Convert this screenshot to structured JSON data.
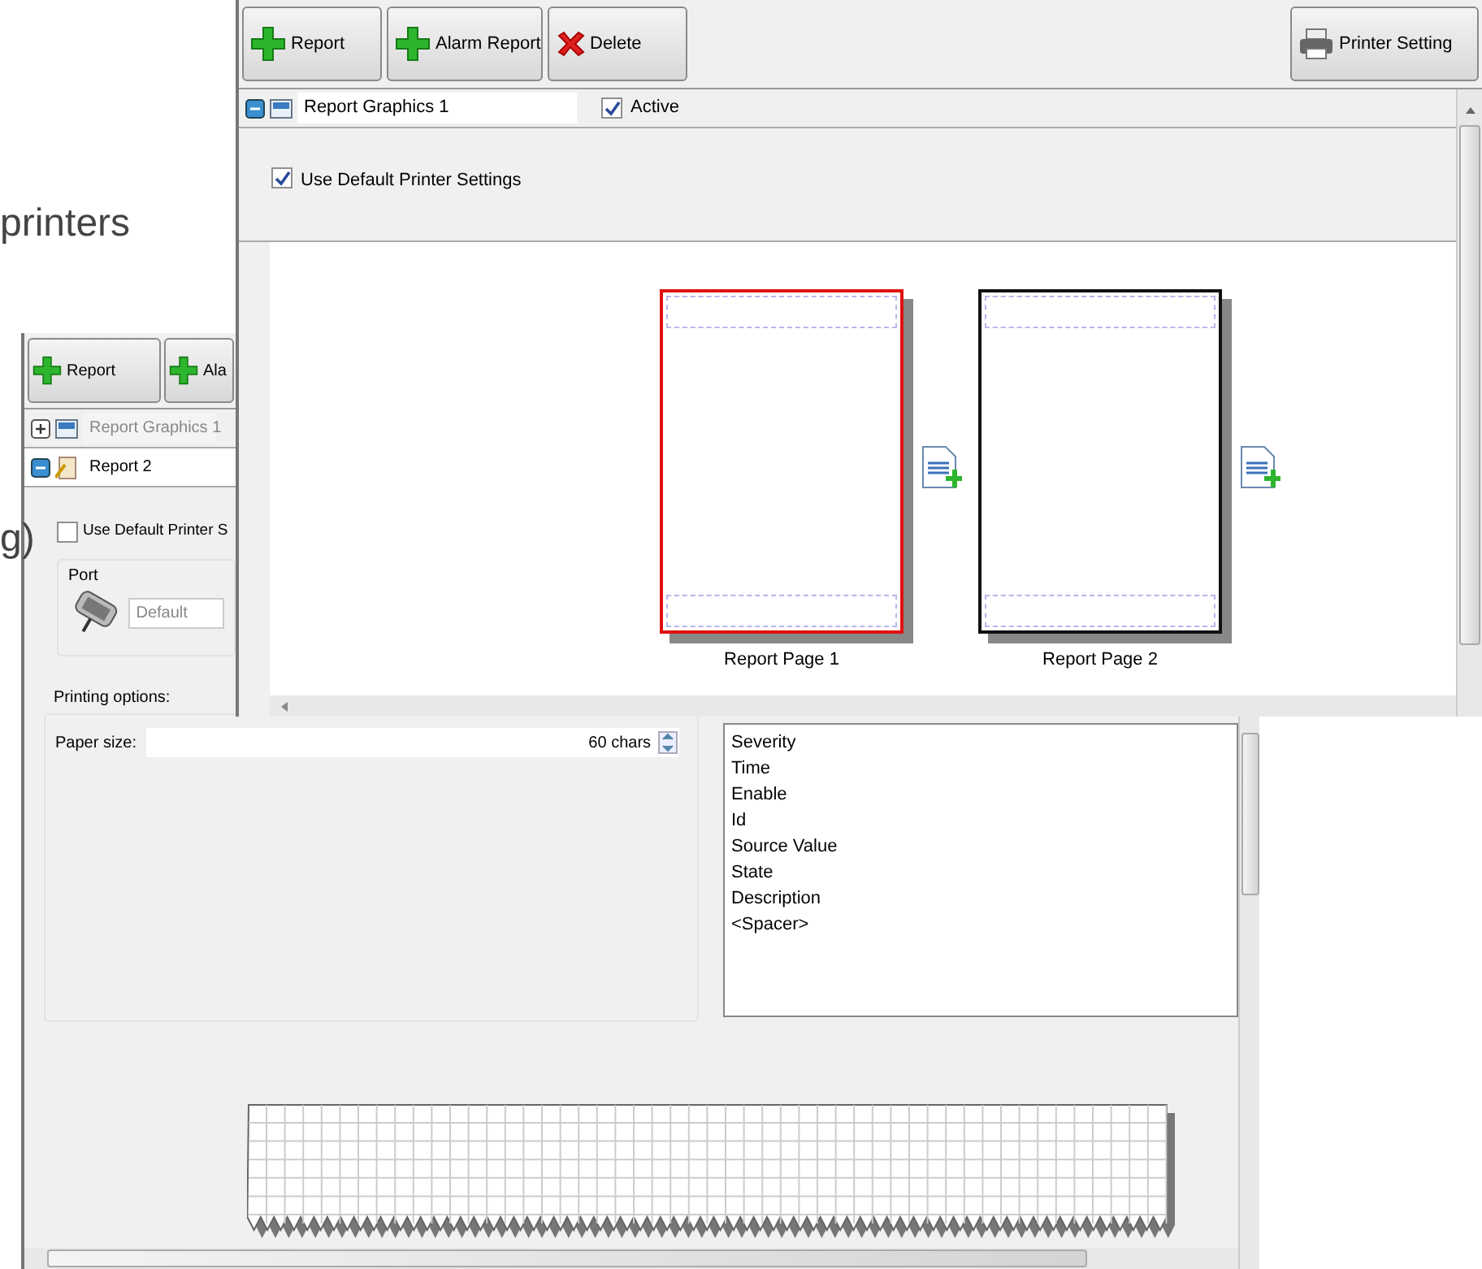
{
  "background_text": [
    "printers",
    "g)"
  ],
  "back_window": {
    "toolbar": [
      {
        "label": "Report",
        "kind": "add"
      },
      {
        "label": "Ala",
        "kind": "add"
      }
    ],
    "tree": [
      {
        "label": "Report Graphics 1",
        "kind": "graphics",
        "expanded": false,
        "selected": false,
        "disabled": true
      },
      {
        "label": "Report 2",
        "kind": "text",
        "expanded": true,
        "selected": true,
        "disabled": false
      }
    ],
    "use_default": {
      "label": "Use Default Printer S",
      "checked": false
    },
    "port": {
      "title": "Port",
      "value": "Default"
    },
    "printing_options": {
      "title": "Printing options:",
      "paper_size_label": "Paper size:",
      "paper_size_value": "60 chars"
    },
    "fields": [
      "Severity",
      "Time",
      "Enable",
      "Id",
      "Source Value",
      "State",
      "Description",
      "<Spacer>"
    ]
  },
  "front_window": {
    "toolbar": [
      {
        "label": "Report",
        "kind": "add"
      },
      {
        "label": "Alarm Report",
        "kind": "add"
      },
      {
        "label": "Delete",
        "kind": "delete"
      }
    ],
    "printer_button": {
      "label": "Printer Setting"
    },
    "tree_row": {
      "label": "Report Graphics 1",
      "expanded": true
    },
    "active": {
      "label": "Active",
      "checked": true
    },
    "use_default": {
      "label": "Use Default Printer Settings",
      "checked": true
    },
    "pages": [
      {
        "label": "Report Page 1",
        "selected": true
      },
      {
        "label": "Report Page 2",
        "selected": false
      }
    ]
  }
}
